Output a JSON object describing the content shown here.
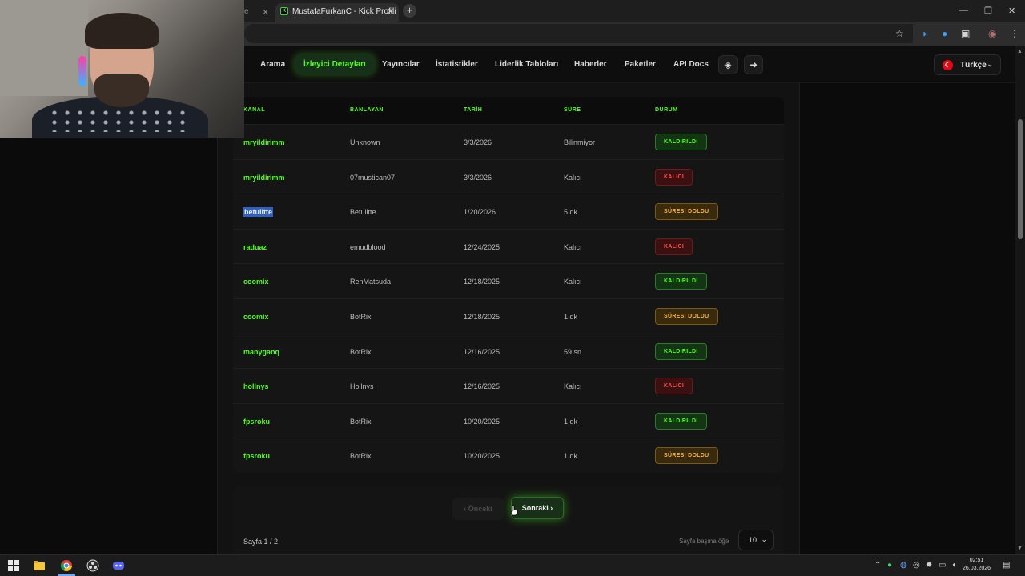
{
  "browser": {
    "partial_tab_text": "e ",
    "active_tab_title": "MustafaFurkanC - Kick Profili",
    "favicon_letter": "K"
  },
  "nav": {
    "items": [
      "Arama",
      "İzleyici Detayları",
      "Yayıncılar",
      "İstatistikler",
      "Liderlik Tabloları",
      "Haberler",
      "Paketler",
      "API Docs"
    ],
    "active_index": 1,
    "language": "Türkçe"
  },
  "table": {
    "headers": [
      "KANAL",
      "BANLAYAN",
      "TARİH",
      "SÜRE",
      "DURUM"
    ],
    "rows": [
      {
        "kanal": "mryildirimm",
        "banlayan": "Unknown",
        "tarih": "3/3/2026",
        "sure": "Bilinmiyor",
        "durum": "KALDIRILDI",
        "type": "kald"
      },
      {
        "kanal": "mryildirimm",
        "banlayan": "07mustican07",
        "tarih": "3/3/2026",
        "sure": "Kalıcı",
        "durum": "KALICI",
        "type": "kalici"
      },
      {
        "kanal": "betulitte",
        "banlayan": "Betulitte",
        "tarih": "1/20/2026",
        "sure": "5 dk",
        "durum": "SÜRESİ DOLDU",
        "type": "suresi",
        "selected": true
      },
      {
        "kanal": "raduaz",
        "banlayan": "emudblood",
        "tarih": "12/24/2025",
        "sure": "Kalıcı",
        "durum": "KALICI",
        "type": "kalici"
      },
      {
        "kanal": "coomix",
        "banlayan": "RenMatsuda",
        "tarih": "12/18/2025",
        "sure": "Kalıcı",
        "durum": "KALDIRILDI",
        "type": "kald"
      },
      {
        "kanal": "coomix",
        "banlayan": "BotRix",
        "tarih": "12/18/2025",
        "sure": "1 dk",
        "durum": "SÜRESİ DOLDU",
        "type": "suresi"
      },
      {
        "kanal": "manyganq",
        "banlayan": "BotRix",
        "tarih": "12/16/2025",
        "sure": "59 sn",
        "durum": "KALDIRILDI",
        "type": "kald"
      },
      {
        "kanal": "hollnys",
        "banlayan": "Hollnys",
        "tarih": "12/16/2025",
        "sure": "Kalıcı",
        "durum": "KALICI",
        "type": "kalici"
      },
      {
        "kanal": "fpsroku",
        "banlayan": "BotRix",
        "tarih": "10/20/2025",
        "sure": "1 dk",
        "durum": "KALDIRILDI",
        "type": "kald"
      },
      {
        "kanal": "fpsroku",
        "banlayan": "BotRix",
        "tarih": "10/20/2025",
        "sure": "1 dk",
        "durum": "SÜRESİ DOLDU",
        "type": "suresi"
      }
    ]
  },
  "pager": {
    "prev_label": "Önceki",
    "next_label": "Sonraki",
    "page_text": "Sayfa 1 / 2",
    "per_page_label": "Sayfa başına öğe:",
    "per_page_value": "10"
  },
  "taskbar": {
    "time": "02:51",
    "date": "26.03.2026"
  },
  "colors": {
    "accent": "#53fc18",
    "kaldirildi": "#53fc18",
    "kalici": "#ff4b4b",
    "suresi_doldu": "#f5b43c"
  }
}
